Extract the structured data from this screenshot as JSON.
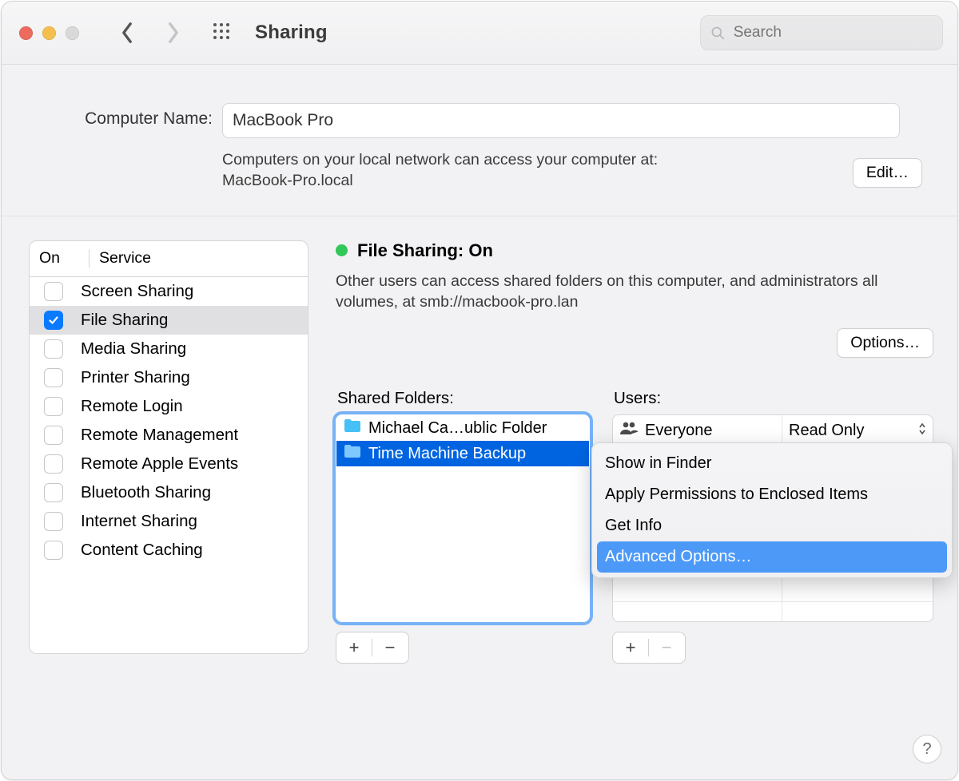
{
  "window": {
    "title": "Sharing",
    "search_placeholder": "Search"
  },
  "computer": {
    "label": "Computer Name:",
    "value": "MacBook Pro",
    "description_prefix": "Computers on your local network can access your computer at:",
    "hostname": "MacBook-Pro.local",
    "edit_label": "Edit…"
  },
  "services": {
    "on_header": "On",
    "service_header": "Service",
    "items": [
      {
        "on": false,
        "label": "Screen Sharing"
      },
      {
        "on": true,
        "label": "File Sharing",
        "selected": true
      },
      {
        "on": false,
        "label": "Media Sharing"
      },
      {
        "on": false,
        "label": "Printer Sharing"
      },
      {
        "on": false,
        "label": "Remote Login"
      },
      {
        "on": false,
        "label": "Remote Management"
      },
      {
        "on": false,
        "label": "Remote Apple Events"
      },
      {
        "on": false,
        "label": "Bluetooth Sharing"
      },
      {
        "on": false,
        "label": "Internet Sharing"
      },
      {
        "on": false,
        "label": "Content Caching"
      }
    ]
  },
  "filesharing": {
    "status_title": "File Sharing: On",
    "status_desc": "Other users can access shared folders on this computer, and administrators all volumes, at smb://macbook-pro.lan",
    "options_label": "Options…",
    "folders_header": "Shared Folders:",
    "users_header": "Users:",
    "folders": [
      {
        "name": "Michael Ca…ublic Folder",
        "selected": false
      },
      {
        "name": "Time Machine Backup",
        "selected": true
      }
    ],
    "users": [
      {
        "name": "Everyone",
        "perm": "Read Only"
      }
    ]
  },
  "context_menu": {
    "items": [
      {
        "label": "Show in Finder"
      },
      {
        "label": "Apply Permissions to Enclosed Items"
      },
      {
        "label": "Get Info"
      },
      {
        "label": "Advanced Options…",
        "highlighted": true
      }
    ]
  },
  "help_label": "?"
}
